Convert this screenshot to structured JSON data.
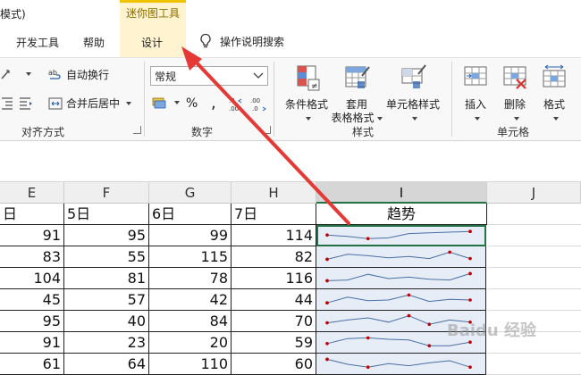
{
  "titlebar": {
    "mode_text": "模式)",
    "context_group": "迷你图工具"
  },
  "tabs": [
    {
      "label": "开发工具"
    },
    {
      "label": "帮助"
    },
    {
      "label": "设计"
    }
  ],
  "search": {
    "label": "操作说明搜索"
  },
  "ribbon": {
    "wrap_text": "自动换行",
    "merge_center": "合并后居中",
    "align_group": "对齐方式",
    "number_format": "常规",
    "percent": "%",
    "comma": ",",
    "number_group": "数字",
    "cond_format": "条件格式",
    "table_format_1": "套用",
    "table_format_2": "表格格式",
    "cell_style": "单元格样式",
    "style_group": "样式",
    "insert": "插入",
    "delete": "删除",
    "format": "格式",
    "cells_group": "单元格"
  },
  "columns": [
    "E",
    "F",
    "G",
    "H",
    "I",
    "J"
  ],
  "header_row": [
    "日",
    "5日",
    "6日",
    "7日",
    "趋势"
  ],
  "rows": [
    [
      "91",
      "95",
      "99",
      "114"
    ],
    [
      "83",
      "55",
      "115",
      "82"
    ],
    [
      "104",
      "81",
      "78",
      "116"
    ],
    [
      "45",
      "57",
      "42",
      "44"
    ],
    [
      "95",
      "40",
      "84",
      "70"
    ],
    [
      "91",
      "23",
      "20",
      "59"
    ],
    [
      "61",
      "64",
      "110",
      "60"
    ]
  ],
  "watermark": "Baidu 经验",
  "colors": {
    "accent_green": "#217346",
    "spark_line": "#4a6fa5",
    "spark_marker": "#c00000",
    "arrow_red": "#e53935"
  }
}
